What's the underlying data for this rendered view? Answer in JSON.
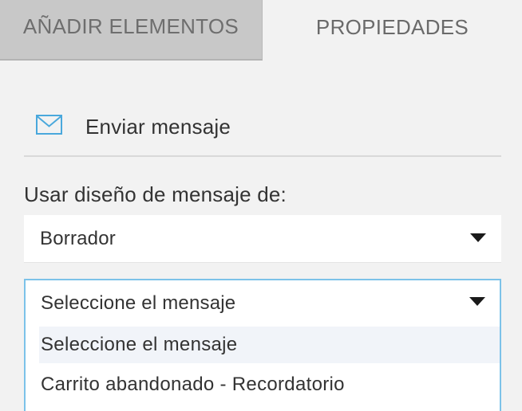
{
  "tabs": [
    {
      "label": "AÑADIR ELEMENTOS",
      "active": false
    },
    {
      "label": "PROPIEDADES",
      "active": true
    }
  ],
  "action": {
    "icon": "mail-icon",
    "title": "Enviar mensaje"
  },
  "design_source": {
    "label": "Usar diseño de mensaje de:",
    "selected": "Borrador"
  },
  "message_select": {
    "selected": "Seleccione el mensaje",
    "options": [
      "Seleccione el mensaje",
      "Carrito abandonado - Recordatorio"
    ]
  },
  "colors": {
    "accent_border": "#7cc2e9",
    "icon_blue": "#4aa8dc",
    "tab_inactive_bg": "#c8c8c8",
    "panel_bg": "#f2f2f2"
  }
}
